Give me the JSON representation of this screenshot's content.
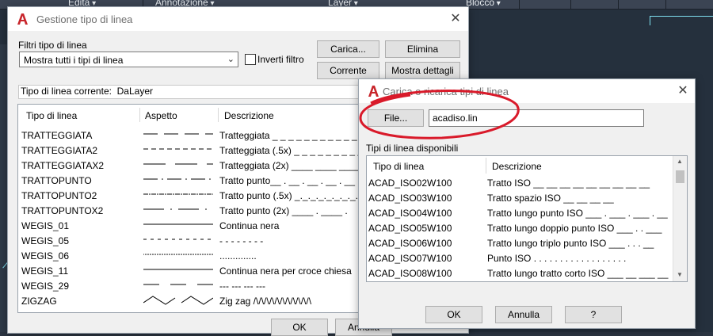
{
  "colors": {
    "accent_red": "#c8262c",
    "annotation_red": "#d91a2a",
    "cyan": "#7fe0f0"
  },
  "ribbon": {
    "items": [
      "Edita",
      "Annotazione",
      "Layer",
      "Blocco"
    ]
  },
  "main_dialog": {
    "title": "Gestione tipo di linea",
    "filter_group_label": "Filtri tipo di linea",
    "filter_value": "Mostra tutti i tipi di linea",
    "invert_filter_label": "Inverti filtro",
    "buttons": {
      "load": "Carica...",
      "delete": "Elimina",
      "current": "Corrente",
      "show_details": "Mostra dettagli"
    },
    "current_linetype_label": "Tipo di linea corrente:",
    "current_linetype_value": "DaLayer",
    "columns": {
      "name": "Tipo di linea",
      "appearance": "Aspetto",
      "description": "Descrizione"
    },
    "rows": [
      {
        "name": "TRATTEGGIATA",
        "desc": "Tratteggiata _ _ _ _ _ _ _ _ _ _ _ _",
        "pattern": "dash"
      },
      {
        "name": "TRATTEGGIATA2",
        "desc": "Tratteggiata (.5x) _ _ _ _ _ _ _ _ _",
        "pattern": "dash-small"
      },
      {
        "name": "TRATTEGGIATAX2",
        "desc": "Tratteggiata (2x) ____  ____  ____",
        "pattern": "dash-large"
      },
      {
        "name": "TRATTOPUNTO",
        "desc": "Tratto punto__ . __ . __ . __ . __ .",
        "pattern": "dashdot"
      },
      {
        "name": "TRATTOPUNTO2",
        "desc": "Tratto punto (.5x) _._._._._._._._.",
        "pattern": "dashdot-small"
      },
      {
        "name": "TRATTOPUNTOX2",
        "desc": "Tratto punto (2x) ____  .  ____  .",
        "pattern": "dashdot-large"
      },
      {
        "name": "WEGIS_01",
        "desc": "Continua nera",
        "pattern": "continuous"
      },
      {
        "name": "WEGIS_05",
        "desc": "- - - - - - - -",
        "pattern": "dash-fine"
      },
      {
        "name": "WEGIS_06",
        "desc": "..............",
        "pattern": "dots"
      },
      {
        "name": "WEGIS_11",
        "desc": "Continua nera per croce chiesa",
        "pattern": "continuous"
      },
      {
        "name": "WEGIS_29",
        "desc": "---  ---  ---  ---",
        "pattern": "dash-sparse"
      },
      {
        "name": "ZIGZAG",
        "desc": "Zig zag /\\/\\/\\/\\/\\/\\/\\/\\/\\/\\/\\",
        "pattern": "zigzag"
      }
    ],
    "ok_label": "OK",
    "cancel_label": "Annulla"
  },
  "load_dialog": {
    "title": "Carica o ricarica tipi di linea",
    "file_button": "File...",
    "file_value": "acadiso.lin",
    "available_label": "Tipi di linea disponibili",
    "columns": {
      "name": "Tipo di linea",
      "description": "Descrizione"
    },
    "rows": [
      {
        "name": "ACAD_ISO02W100",
        "desc": "Tratto ISO __ __ __ __ __ __ __ __ __"
      },
      {
        "name": "ACAD_ISO03W100",
        "desc": "Tratto spazio ISO __    __    __    __"
      },
      {
        "name": "ACAD_ISO04W100",
        "desc": "Tratto lungo punto ISO ___ . ___ . ___ . __"
      },
      {
        "name": "ACAD_ISO05W100",
        "desc": "Tratto lungo doppio punto ISO ___ . . ___"
      },
      {
        "name": "ACAD_ISO06W100",
        "desc": "Tratto lungo triplo punto ISO ___ . . . __"
      },
      {
        "name": "ACAD_ISO07W100",
        "desc": "Punto ISO . . . . . . . . . . . . . . . . . ."
      },
      {
        "name": "ACAD_ISO08W100",
        "desc": "Tratto lungo tratto corto ISO ___ __ ___ __"
      }
    ],
    "ok_label": "OK",
    "cancel_label": "Annulla",
    "help_label": "?"
  }
}
